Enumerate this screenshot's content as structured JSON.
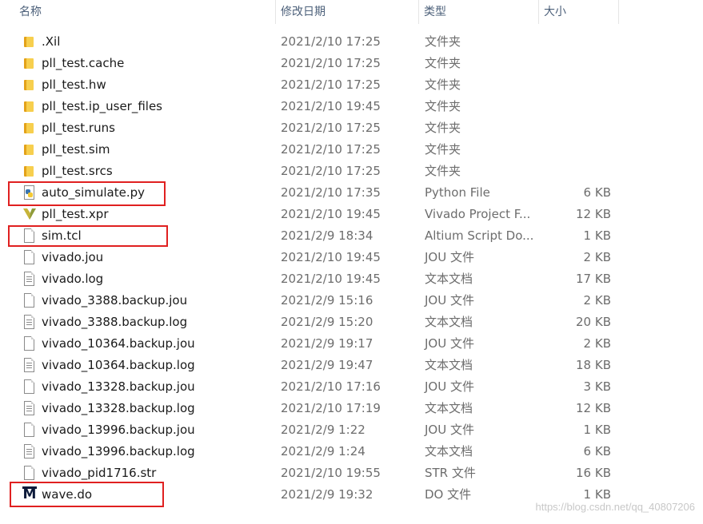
{
  "header": {
    "name": "名称",
    "date": "修改日期",
    "type": "类型",
    "size": "大小",
    "sort_icon": "chevron-up-icon"
  },
  "files": [
    {
      "icon": "folder-icon",
      "name": ".Xil",
      "date": "2021/2/10 17:25",
      "type": "文件夹",
      "size": ""
    },
    {
      "icon": "folder-icon",
      "name": "pll_test.cache",
      "date": "2021/2/10 17:25",
      "type": "文件夹",
      "size": ""
    },
    {
      "icon": "folder-icon",
      "name": "pll_test.hw",
      "date": "2021/2/10 17:25",
      "type": "文件夹",
      "size": ""
    },
    {
      "icon": "folder-icon",
      "name": "pll_test.ip_user_files",
      "date": "2021/2/10 19:45",
      "type": "文件夹",
      "size": ""
    },
    {
      "icon": "folder-icon",
      "name": "pll_test.runs",
      "date": "2021/2/10 17:25",
      "type": "文件夹",
      "size": ""
    },
    {
      "icon": "folder-icon",
      "name": "pll_test.sim",
      "date": "2021/2/10 17:25",
      "type": "文件夹",
      "size": ""
    },
    {
      "icon": "folder-icon",
      "name": "pll_test.srcs",
      "date": "2021/2/10 17:25",
      "type": "文件夹",
      "size": ""
    },
    {
      "icon": "python-file-icon",
      "name": "auto_simulate.py",
      "date": "2021/2/10 17:35",
      "type": "Python File",
      "size": "6 KB"
    },
    {
      "icon": "vivado-project-icon",
      "name": "pll_test.xpr",
      "date": "2021/2/10 19:45",
      "type": "Vivado Project F...",
      "size": "12 KB"
    },
    {
      "icon": "blank-file-icon",
      "name": "sim.tcl",
      "date": "2021/2/9 18:34",
      "type": "Altium Script Do...",
      "size": "1 KB"
    },
    {
      "icon": "blank-file-icon",
      "name": "vivado.jou",
      "date": "2021/2/10 19:45",
      "type": "JOU 文件",
      "size": "2 KB"
    },
    {
      "icon": "text-file-icon",
      "name": "vivado.log",
      "date": "2021/2/10 19:45",
      "type": "文本文档",
      "size": "17 KB"
    },
    {
      "icon": "blank-file-icon",
      "name": "vivado_3388.backup.jou",
      "date": "2021/2/9 15:16",
      "type": "JOU 文件",
      "size": "2 KB"
    },
    {
      "icon": "text-file-icon",
      "name": "vivado_3388.backup.log",
      "date": "2021/2/9 15:20",
      "type": "文本文档",
      "size": "20 KB"
    },
    {
      "icon": "blank-file-icon",
      "name": "vivado_10364.backup.jou",
      "date": "2021/2/9 19:17",
      "type": "JOU 文件",
      "size": "2 KB"
    },
    {
      "icon": "text-file-icon",
      "name": "vivado_10364.backup.log",
      "date": "2021/2/9 19:47",
      "type": "文本文档",
      "size": "18 KB"
    },
    {
      "icon": "blank-file-icon",
      "name": "vivado_13328.backup.jou",
      "date": "2021/2/10 17:16",
      "type": "JOU 文件",
      "size": "3 KB"
    },
    {
      "icon": "text-file-icon",
      "name": "vivado_13328.backup.log",
      "date": "2021/2/10 17:19",
      "type": "文本文档",
      "size": "12 KB"
    },
    {
      "icon": "blank-file-icon",
      "name": "vivado_13996.backup.jou",
      "date": "2021/2/9 1:22",
      "type": "JOU 文件",
      "size": "1 KB"
    },
    {
      "icon": "text-file-icon",
      "name": "vivado_13996.backup.log",
      "date": "2021/2/9 1:24",
      "type": "文本文档",
      "size": "6 KB"
    },
    {
      "icon": "blank-file-icon",
      "name": "vivado_pid1716.str",
      "date": "2021/2/10 19:55",
      "type": "STR 文件",
      "size": "16 KB"
    },
    {
      "icon": "modelsim-do-icon",
      "name": "wave.do",
      "date": "2021/2/9 19:32",
      "type": "DO 文件",
      "size": "1 KB"
    }
  ],
  "watermark": "https://blog.csdn.net/qq_40807206",
  "colors": {
    "highlight": "#e02020",
    "header_text": "#4c607a",
    "folder": "#f7cf4e"
  }
}
